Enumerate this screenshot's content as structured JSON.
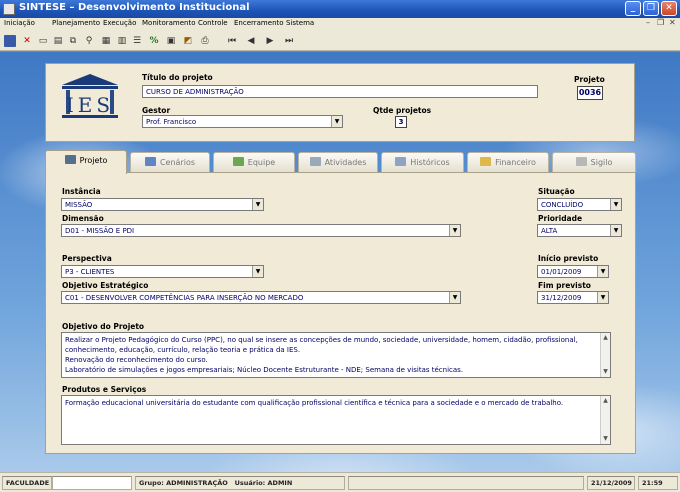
{
  "window": {
    "title": "SINTESE – Desenvolvimento Institucional",
    "minimize": "_",
    "maximize": "❐",
    "close": "✕"
  },
  "menu": [
    "Iniciação",
    "Planejamento",
    "Execução",
    "Monitoramento",
    "Controle",
    "Encerramento",
    "Sistema"
  ],
  "mdi_controls": {
    "minimize": "–",
    "restore": "❐",
    "close": "✕"
  },
  "toolbar_icons": [
    "save-icon",
    "cancel-icon",
    "new-icon",
    "open-icon",
    "copy-icon",
    "find-icon",
    "grid-icon",
    "report-icon",
    "properties-icon",
    "calculator-icon",
    "edit-icon",
    "chart-icon",
    "print-icon",
    "first-record-icon",
    "previous-record-icon",
    "next-record-icon",
    "last-record-icon"
  ],
  "navigation": {
    "first": "⏮",
    "prev": "◀",
    "next": "▶",
    "last": "⏭"
  },
  "header": {
    "logo_text": "IES",
    "titulo_label": "Título do projeto",
    "titulo_value": "CURSO DE ADMINISTRAÇÃO",
    "projeto_label": "Projeto",
    "projeto_value": "0036",
    "gestor_label": "Gestor",
    "gestor_value": "Prof. Francisco",
    "qtde_label": "Qtde projetos",
    "qtde_value": "3"
  },
  "tabs": [
    {
      "label": "Projeto",
      "icon": "projeto-icon",
      "active": true
    },
    {
      "label": "Cenários",
      "icon": "cenarios-icon",
      "active": false
    },
    {
      "label": "Equipe",
      "icon": "equipe-icon",
      "active": false
    },
    {
      "label": "Atividades",
      "icon": "atividades-icon",
      "active": false
    },
    {
      "label": "Históricos",
      "icon": "historicos-icon",
      "active": false
    },
    {
      "label": "Financeiro",
      "icon": "financeiro-icon",
      "active": false
    },
    {
      "label": "Sigilo",
      "icon": "sigilo-icon",
      "active": false
    }
  ],
  "form": {
    "instancia_label": "Instância",
    "instancia_value": "MISSÃO",
    "dimensao_label": "Dimensão",
    "dimensao_value": "D01 - MISSÃO E PDI",
    "perspectiva_label": "Perspectiva",
    "perspectiva_value": "P3 - CLIENTES",
    "objetivo_label": "Objetivo Estratégico",
    "objetivo_value": "C01 - DESENVOLVER COMPETÊNCIAS PARA INSERÇÃO NO MERCADO",
    "situacao_label": "Situação",
    "situacao_value": "CONCLUÍDO",
    "prioridade_label": "Prioridade",
    "prioridade_value": "ALTA",
    "inicio_label": "Início previsto",
    "inicio_value": "01/01/2009",
    "fim_label": "Fim previsto",
    "fim_value": "31/12/2009",
    "objetivo_projeto_label": "Objetivo do Projeto",
    "objetivo_projeto_lines": [
      "Realizar o Projeto Pedagógico do Curso (PPC),  no qual se insere as concepções de mundo, sociedade, universidade, homem, cidadão, profissional,",
      "conhecimento, educação, currículo, relação teoria e prática da IES.",
      "Renovação do reconhecimento do curso.",
      "Laboratório de simulações e jogos empresariais; Núcleo Docente Estruturante - NDE; Semana de visitas técnicas."
    ],
    "produtos_label": "Produtos e Serviços",
    "produtos_value": "Formação educacional universitária do estudante com qualificação profissional científica e técnica para a sociedade e o mercado de trabalho."
  },
  "status": {
    "faculdade_label": "FACULDADE",
    "grupo": "Grupo: ADMINISTRAÇÃO",
    "usuario": "Usuário: ADMIN",
    "date": "21/12/2009",
    "time": "21:59"
  },
  "colors": {
    "titlebar": "#1d54b6",
    "panel": "#f1ead7",
    "field_text": "#000066"
  }
}
